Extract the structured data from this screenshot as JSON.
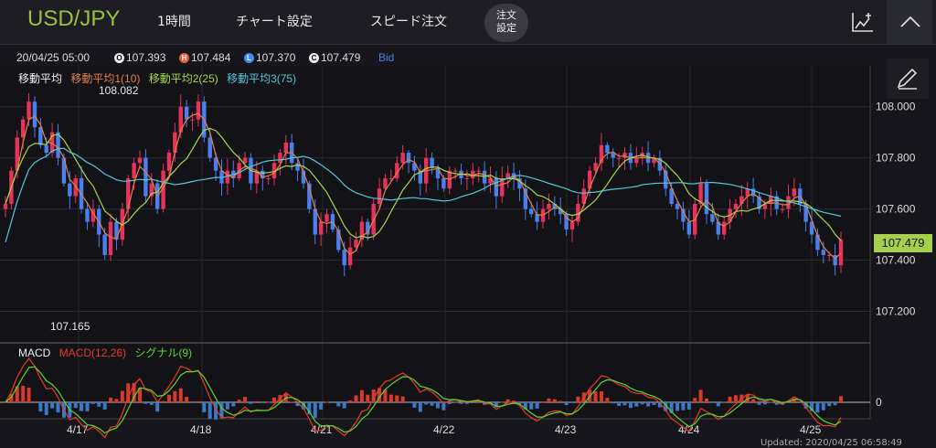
{
  "header": {
    "symbol": "USD/JPY",
    "timeframe": "1時間",
    "chart_settings": "チャート設定",
    "speed_order": "スピード注文",
    "order_settings_line1": "注文",
    "order_settings_line2": "設定"
  },
  "ohlc": {
    "datetime": "20/04/25 05:00",
    "open_badge": "O",
    "open": "107.393",
    "high_badge": "H",
    "high": "107.484",
    "low_badge": "L",
    "low": "107.370",
    "close_badge": "C",
    "close": "107.479",
    "side": "Bid"
  },
  "legend": {
    "ma_title": "移動平均",
    "ma1": "移動平均1(10)",
    "ma2": "移動平均2(25)",
    "ma3": "移動平均3(75)",
    "macd_title": "MACD",
    "macd": "MACD(12,26)",
    "signal": "シグナル(9)"
  },
  "annotations": {
    "max_label": "108.082",
    "min_label": "107.165",
    "current_price": "107.479"
  },
  "footer": {
    "updated": "Updated: 2020/04/25 06:58:49"
  },
  "colors": {
    "up": "#e8325a",
    "down": "#4a7ff0",
    "ma1": "#e0804a",
    "ma2": "#a8d848",
    "ma3": "#52c8d8",
    "macd": "#e83a2a",
    "signal": "#5ad82a",
    "hist_pos": "#d83a2a",
    "hist_neg": "#3a78c8"
  },
  "chart_data": [
    {
      "type": "candlestick",
      "price_axis": {
        "ticks": [
          "107.200",
          "107.400",
          "107.600",
          "107.800",
          "108.000"
        ],
        "range": [
          107.08,
          108.16
        ]
      },
      "x_ticks": [
        "4/17",
        "4/18",
        "4/21",
        "4/22",
        "4/23",
        "4/24",
        "4/25"
      ],
      "ma_values_approx": {
        "ma1_end": 107.47,
        "ma2_end": 107.58,
        "ma3_end": 107.66
      },
      "closes_approx": [
        107.62,
        107.75,
        107.88,
        107.95,
        108.02,
        107.92,
        107.85,
        107.82,
        107.9,
        107.8,
        107.7,
        107.65,
        107.72,
        107.6,
        107.55,
        107.6,
        107.5,
        107.42,
        107.55,
        107.48,
        107.6,
        107.72,
        107.78,
        107.8,
        107.65,
        107.7,
        107.6,
        107.75,
        107.82,
        107.9,
        108.0,
        107.95,
        107.95,
        108.02,
        107.88,
        107.8,
        107.75,
        107.7,
        107.75,
        107.72,
        107.78,
        107.8,
        107.7,
        107.75,
        107.72,
        107.72,
        107.78,
        107.82,
        107.86,
        107.78,
        107.75,
        107.7,
        107.6,
        107.5,
        107.55,
        107.58,
        107.52,
        107.44,
        107.38,
        107.45,
        107.48,
        107.55,
        107.5,
        107.62,
        107.68,
        107.72,
        107.72,
        107.78,
        107.82,
        107.78,
        107.75,
        107.7,
        107.8,
        107.76,
        107.72,
        107.68,
        107.75,
        107.75,
        107.72,
        107.72,
        107.75,
        107.75,
        107.7,
        107.72,
        107.65,
        107.72,
        107.74,
        107.72,
        107.68,
        107.6,
        107.58,
        107.55,
        107.6,
        107.62,
        107.6,
        107.58,
        107.52,
        107.55,
        107.62,
        107.68,
        107.75,
        107.78,
        107.85,
        107.82,
        107.8,
        107.8,
        107.82,
        107.78,
        107.8,
        107.82,
        107.78,
        107.8,
        107.75,
        107.68,
        107.62,
        107.6,
        107.55,
        107.5,
        107.62,
        107.7,
        107.58,
        107.55,
        107.5,
        107.55,
        107.6,
        107.62,
        107.65,
        107.68,
        107.65,
        107.6,
        107.62,
        107.65,
        107.6,
        107.6,
        107.65,
        107.68,
        107.62,
        107.55,
        107.5,
        107.44,
        107.42,
        107.42,
        107.38,
        107.48
      ]
    },
    {
      "type": "macd",
      "zero_label": "0",
      "series": [
        {
          "name": "MACD(12,26)"
        },
        {
          "name": "シグナル(9)"
        }
      ]
    }
  ]
}
